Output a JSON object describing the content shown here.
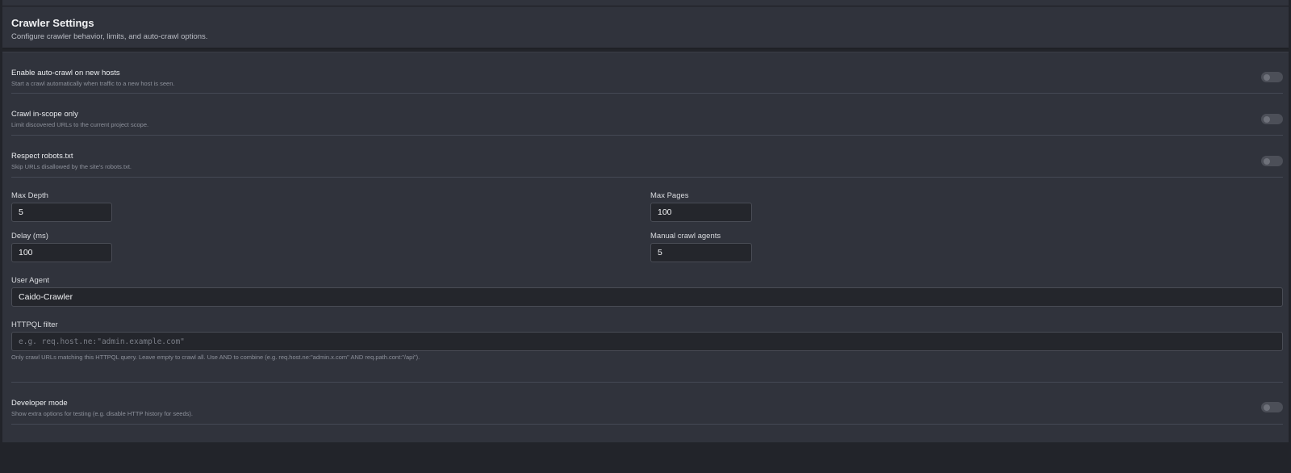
{
  "header": {
    "title": "Crawler Settings",
    "subtitle": "Configure crawler behavior, limits, and auto-crawl options."
  },
  "toggles": [
    {
      "label": "Enable auto-crawl on new hosts",
      "description": "Start a crawl automatically when traffic to a new host is seen.",
      "enabled": false
    },
    {
      "label": "Crawl in-scope only",
      "description": "Limit discovered URLs to the current project scope.",
      "enabled": false
    },
    {
      "label": "Respect robots.txt",
      "description": "Skip URLs disallowed by the site's robots.txt.",
      "enabled": false
    }
  ],
  "fields": {
    "max_depth": {
      "label": "Max Depth",
      "value": "5"
    },
    "max_pages": {
      "label": "Max Pages",
      "value": "100"
    },
    "delay": {
      "label": "Delay (ms)",
      "value": "100"
    },
    "agents": {
      "label": "Manual crawl agents",
      "value": "5"
    },
    "user_agent": {
      "label": "User Agent",
      "value": "Caido-Crawler"
    },
    "httpql": {
      "label": "HTTPQL filter",
      "value": "",
      "placeholder": "e.g. req.host.ne:\"admin.example.com\"",
      "hint": "Only crawl URLs matching this HTTPQL query. Leave empty to crawl all. Use AND to combine (e.g. req.host.ne:\"admin.x.com\" AND req.path.cont:\"/api\")."
    }
  },
  "developer": {
    "label": "Developer mode",
    "description": "Show extra options for testing (e.g. disable HTTP history for seeds).",
    "enabled": false
  }
}
